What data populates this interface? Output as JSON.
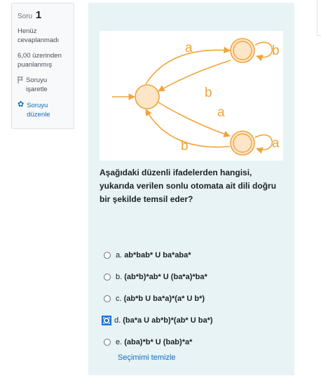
{
  "info": {
    "question_label": "Soru",
    "question_number": "1",
    "status_line1": "Henüz",
    "status_line2": "cevaplanmadı",
    "points_line1": "6,00 üzerinden",
    "points_line2": "puanlanmış",
    "flag_line1": "Soruyu",
    "flag_line2": "işaretle",
    "edit_line1": "Soruyu",
    "edit_line2": "düzenle"
  },
  "diagram": {
    "state_fill": "#fde5c8",
    "state_stroke": "#f0a43a",
    "arrow_color": "#f0a43a",
    "label_color": "#f0a43a",
    "labels": {
      "top_a": "a",
      "mid_b": "b",
      "mid_a": "a",
      "bottom_b": "b",
      "loop_top_b": "b",
      "loop_bottom_a": "a"
    }
  },
  "question": {
    "text": "Aşağıdaki düzenli ifadelerden hangisi, yukarıda verilen sonlu otomata ait dili doğru bir şekilde temsil eder?"
  },
  "answers": [
    {
      "letter": "a.",
      "text": "ab*bab* U ba*aba*"
    },
    {
      "letter": "b.",
      "text": "(ab*b)*ab* U (ba*a)*ba*"
    },
    {
      "letter": "c.",
      "text": "(ab*b U ba*a)*(a* U b*)"
    },
    {
      "letter": "d.",
      "text": "(ba*a U ab*b)*(ab* U ba*)"
    },
    {
      "letter": "e.",
      "text": "(aba)*b* U (bab)*a*"
    }
  ],
  "selected_index": 3,
  "clear_label": "Seçimimi temizle",
  "colors": {
    "link": "#0f6cbf",
    "card_bg": "#e7f3f5"
  }
}
